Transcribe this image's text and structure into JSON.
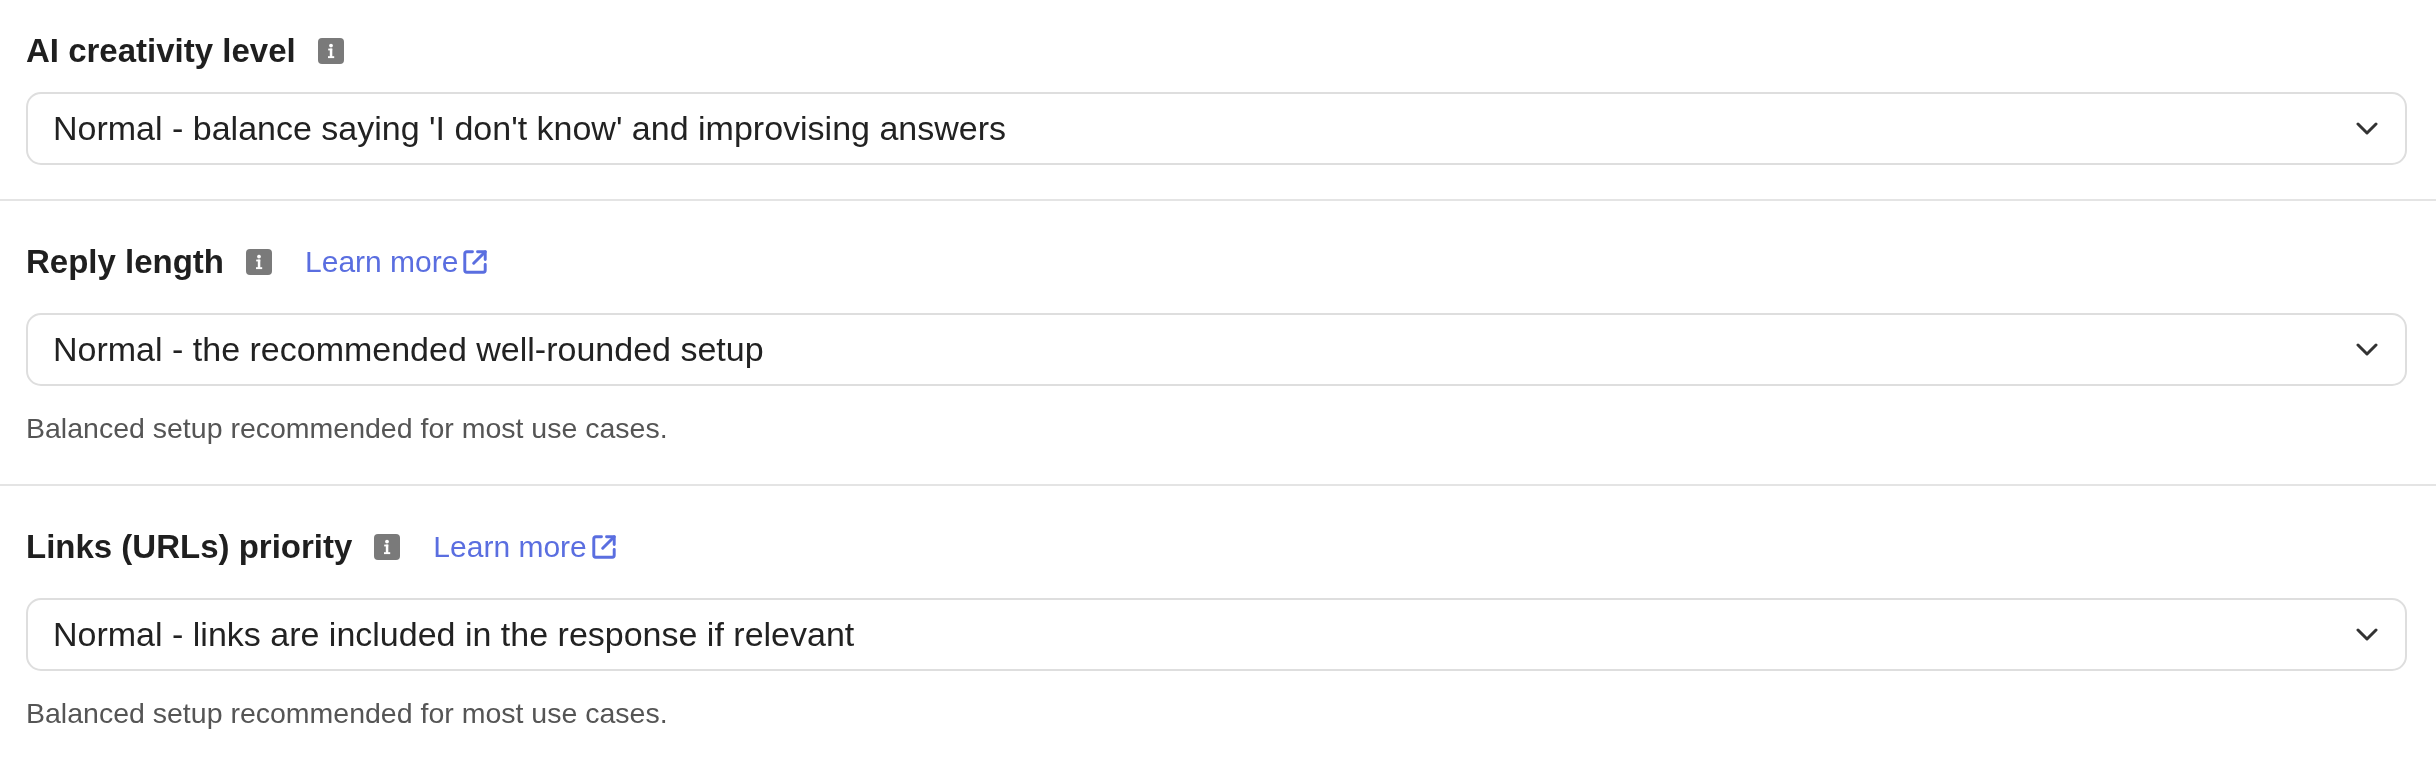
{
  "settings": [
    {
      "label": "AI creativity level",
      "value": "Normal - balance saying 'I don't know' and improvising answers"
    },
    {
      "label": "Reply length",
      "link": "Learn more",
      "value": "Normal - the recommended well-rounded setup",
      "helper": "Balanced setup recommended for most use cases."
    },
    {
      "label": "Links (URLs) priority",
      "link": "Learn more",
      "value": "Normal - links are included in the response if relevant",
      "helper": "Balanced setup recommended for most use cases."
    }
  ]
}
